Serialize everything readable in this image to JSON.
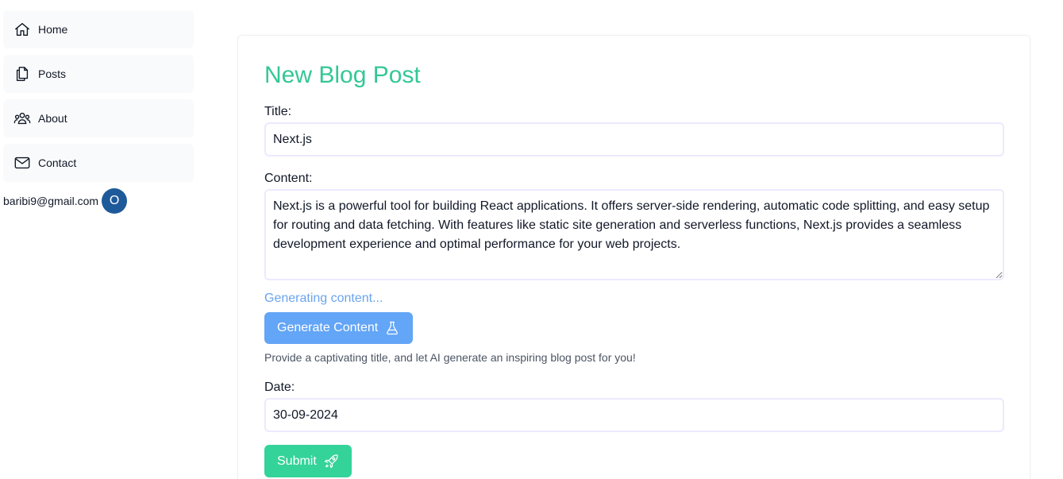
{
  "sidebar": {
    "items": [
      {
        "label": "Home",
        "icon": "home-icon"
      },
      {
        "label": "Posts",
        "icon": "documents-icon"
      },
      {
        "label": "About",
        "icon": "users-icon"
      },
      {
        "label": "Contact",
        "icon": "envelope-icon"
      }
    ],
    "user": {
      "email": "baribi9@gmail.com",
      "avatar_initial": "O"
    }
  },
  "form": {
    "title": "New Blog Post",
    "title_label": "Title:",
    "title_value": "Next.js",
    "content_label": "Content:",
    "content_value": "Next.js is a powerful tool for building React applications. It offers server-side rendering, automatic code splitting, and easy setup for routing and data fetching. With features like static site generation and serverless functions, Next.js provides a seamless development experience and optimal performance for your web projects.",
    "status": "Generating content...",
    "generate_label": "Generate Content",
    "generate_icon": "flask-icon",
    "helper": "Provide a captivating title, and let AI generate an inspiring blog post for you!",
    "date_label": "Date:",
    "date_value": "30-09-2024",
    "submit_label": "Submit",
    "submit_icon": "rocket-icon"
  },
  "colors": {
    "accent_green": "#34c796",
    "generate_button": "#63a5f6",
    "submit_button": "#34d399",
    "avatar": "#1e5a9a"
  }
}
